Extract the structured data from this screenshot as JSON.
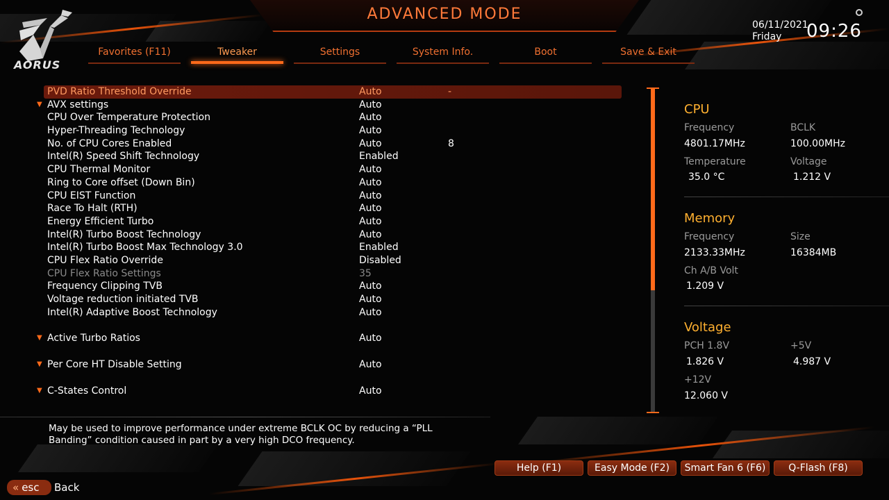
{
  "header": {
    "title": "ADVANCED MODE",
    "logo_text": "AORUS",
    "date": "06/11/2021",
    "day": "Friday",
    "time": "09:26"
  },
  "tabs": [
    {
      "label": "Favorites (F11)",
      "active": false
    },
    {
      "label": "Tweaker",
      "active": true
    },
    {
      "label": "Settings",
      "active": false
    },
    {
      "label": "System Info.",
      "active": false
    },
    {
      "label": "Boot",
      "active": false
    },
    {
      "label": "Save & Exit",
      "active": false
    }
  ],
  "settings": [
    {
      "label": "PVD Ratio Threshold Override",
      "value": "Auto",
      "extra": "-",
      "selected": true
    },
    {
      "label": "AVX settings",
      "value": "Auto",
      "extra": "",
      "arrow": true
    },
    {
      "label": "CPU Over Temperature Protection",
      "value": "Auto",
      "extra": ""
    },
    {
      "label": "Hyper-Threading Technology",
      "value": "Auto",
      "extra": ""
    },
    {
      "label": "No. of CPU Cores Enabled",
      "value": "Auto",
      "extra": "8"
    },
    {
      "label": "Intel(R) Speed Shift Technology",
      "value": "Enabled",
      "extra": ""
    },
    {
      "label": "CPU Thermal Monitor",
      "value": "Auto",
      "extra": ""
    },
    {
      "label": "Ring to Core offset (Down Bin)",
      "value": "Auto",
      "extra": ""
    },
    {
      "label": "CPU EIST Function",
      "value": "Auto",
      "extra": ""
    },
    {
      "label": "Race To Halt (RTH)",
      "value": "Auto",
      "extra": ""
    },
    {
      "label": "Energy Efficient Turbo",
      "value": "Auto",
      "extra": ""
    },
    {
      "label": "Intel(R) Turbo Boost Technology",
      "value": "Auto",
      "extra": ""
    },
    {
      "label": "Intel(R) Turbo Boost Max Technology 3.0",
      "value": "Enabled",
      "extra": ""
    },
    {
      "label": "CPU Flex Ratio Override",
      "value": "Disabled",
      "extra": ""
    },
    {
      "label": "CPU Flex Ratio Settings",
      "value": "35",
      "extra": "",
      "disabled": true
    },
    {
      "label": "Frequency Clipping TVB",
      "value": "Auto",
      "extra": ""
    },
    {
      "label": "Voltage reduction initiated TVB",
      "value": "Auto",
      "extra": ""
    },
    {
      "label": "Intel(R) Adaptive Boost Technology",
      "value": "Auto",
      "extra": ""
    },
    {
      "label": "Active Turbo Ratios",
      "value": "Auto",
      "extra": "",
      "arrow": true,
      "gap": true
    },
    {
      "label": "Per Core HT Disable Setting",
      "value": "Auto",
      "extra": "",
      "arrow": true,
      "gap": true
    },
    {
      "label": "C-States Control",
      "value": "Auto",
      "extra": "",
      "arrow": true,
      "gap": true
    }
  ],
  "help_text": "May be used to improve performance under extreme BCLK OC by reducing a “PLL Banding” condition caused in part by a very high DCO frequency.",
  "hardware": {
    "cpu": {
      "title": "CPU",
      "freq_label": "Frequency",
      "freq_value": "4801.17MHz",
      "bclk_label": "BCLK",
      "bclk_value": "100.00MHz",
      "temp_label": "Temperature",
      "temp_value": "35.0 °C",
      "volt_label": "Voltage",
      "volt_value": "1.212 V"
    },
    "memory": {
      "title": "Memory",
      "freq_label": "Frequency",
      "freq_value": "2133.33MHz",
      "size_label": "Size",
      "size_value": "16384MB",
      "chvolt_label": "Ch A/B Volt",
      "chvolt_value": "1.209 V"
    },
    "voltage": {
      "title": "Voltage",
      "pch_label": "PCH 1.8V",
      "pch_value": "1.826 V",
      "v5_label": "+5V",
      "v5_value": "4.987 V",
      "v12_label": "+12V",
      "v12_value": "12.060 V"
    }
  },
  "footer": {
    "buttons": [
      "Help (F1)",
      "Easy Mode (F2)",
      "Smart Fan 6 (F6)",
      "Q-Flash (F8)"
    ],
    "esc_label": "esc",
    "back_label": "Back"
  },
  "colors": {
    "accent": "#ff6a1a",
    "title": "#ff7a3a",
    "hw_title": "#ffb030",
    "selected_row": "#6b1a0c"
  }
}
